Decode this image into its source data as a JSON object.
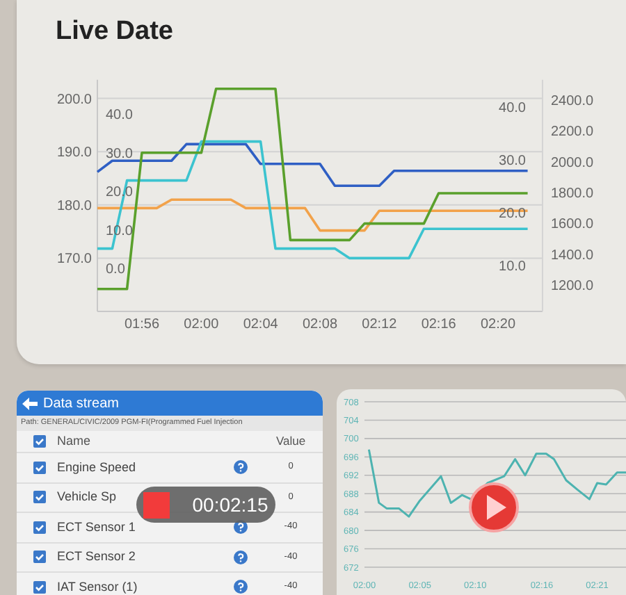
{
  "title": "Live Date",
  "live_chart": {
    "chart_data": {
      "type": "line",
      "grid": true,
      "x": [
        113,
        114,
        115,
        116,
        117,
        118,
        119,
        120,
        121,
        122,
        123,
        124,
        125,
        126,
        127,
        128,
        129,
        130,
        131,
        132,
        133,
        134,
        135,
        136,
        137,
        138,
        139,
        140,
        141,
        142
      ],
      "xlim": [
        113,
        143
      ],
      "ylim": [
        160,
        203.5
      ],
      "xticks": [
        {
          "value": 116,
          "label": "01:56"
        },
        {
          "value": 120,
          "label": "02:00"
        },
        {
          "value": 124,
          "label": "02:04"
        },
        {
          "value": 128,
          "label": "02:08"
        },
        {
          "value": 132,
          "label": "02:12"
        },
        {
          "value": 136,
          "label": "02:16"
        },
        {
          "value": 140,
          "label": "02:20"
        }
      ],
      "yticks": [
        {
          "value": 170,
          "label": "170.0"
        },
        {
          "value": 180,
          "label": "180.0"
        },
        {
          "value": 190,
          "label": "190.0"
        },
        {
          "value": 200,
          "label": "200.0"
        }
      ],
      "series": [
        {
          "color": "#2f5fc4",
          "values": [
            186.2,
            188.3,
            188.3,
            188.3,
            188.3,
            188.3,
            191.4,
            191.4,
            191.4,
            191.4,
            191.4,
            187.7,
            187.7,
            187.7,
            187.7,
            187.7,
            183.6,
            183.6,
            183.6,
            183.6,
            186.4,
            186.4,
            186.4,
            186.4,
            186.4,
            186.4,
            186.4,
            186.4,
            186.4,
            186.4
          ]
        },
        {
          "color": "#f2a24a",
          "values": [
            179.4,
            179.4,
            179.4,
            179.4,
            179.4,
            181,
            181,
            181,
            181,
            181,
            179.4,
            179.4,
            179.4,
            179.4,
            179.4,
            175.2,
            175.2,
            175.2,
            175.2,
            178.9,
            178.9,
            178.9,
            178.9,
            178.9,
            178.9,
            178.9,
            178.9,
            178.9,
            178.9,
            178.9
          ]
        },
        {
          "color": "#3cc3cf",
          "values": [
            171.8,
            171.8,
            184.6,
            184.6,
            184.6,
            184.6,
            184.6,
            191.9,
            191.9,
            191.9,
            191.9,
            191.9,
            171.8,
            171.8,
            171.8,
            171.8,
            171.8,
            170,
            170,
            170,
            170,
            170,
            175.5,
            175.5,
            175.5,
            175.5,
            175.5,
            175.5,
            175.5,
            175.5
          ]
        },
        {
          "color": "#5aa02c",
          "values": [
            164.2,
            164.2,
            164.2,
            189.8,
            189.8,
            189.8,
            189.8,
            189.8,
            201.8,
            201.8,
            201.8,
            201.8,
            201.8,
            173.4,
            173.4,
            173.4,
            173.4,
            173.4,
            176.5,
            176.5,
            176.5,
            176.5,
            176.5,
            182.2,
            182.2,
            182.2,
            182.2,
            182.2,
            182.2,
            182.2
          ]
        }
      ]
    },
    "extra_axes": [
      {
        "kind": "inner_left",
        "ticks": [
          "40.0",
          "30.0",
          "20.0",
          "10.0",
          "0.0"
        ]
      },
      {
        "kind": "inner_right",
        "ticks": [
          "40.0",
          "30.0",
          "20.0",
          "10.0"
        ]
      },
      {
        "kind": "right",
        "ticks": [
          "2400.0",
          "2200.0",
          "2000.0",
          "1800.0",
          "1600.0",
          "1400.0",
          "1200.0"
        ]
      }
    ]
  },
  "data_stream": {
    "title": "Data stream",
    "path": "Path:  GENERAL/CIVIC/2009 PGM-FI(Programmed Fuel Injection",
    "header": {
      "checked": true,
      "name": "Name",
      "value": "Value"
    },
    "rows": [
      {
        "checked": true,
        "name": "Engine Speed",
        "info_icon": true,
        "value": "0"
      },
      {
        "checked": true,
        "name": "Vehicle Sp",
        "info_icon": false,
        "value": "0"
      },
      {
        "checked": true,
        "name": "ECT Sensor 1",
        "info_icon": true,
        "value": "-40"
      },
      {
        "checked": true,
        "name": "ECT Sensor 2",
        "info_icon": true,
        "value": "-40"
      },
      {
        "checked": true,
        "name": "IAT Sensor (1)",
        "info_icon": true,
        "value": "-40"
      }
    ],
    "recording": {
      "time": "00:02:15"
    }
  },
  "video_chart": {
    "chart_data": {
      "type": "line",
      "grid": true,
      "x": [
        120.4,
        121.3,
        122.0,
        123.1,
        124.0,
        125.0,
        126.9,
        127.8,
        128.8,
        129.6,
        131.1,
        132.6,
        133.6,
        134.5,
        135.5,
        136.4,
        137.1,
        138.2,
        139.2,
        140.3,
        141.0,
        141.8,
        142.8,
        143.6
      ],
      "xlim": [
        120,
        143.6
      ],
      "ylim": [
        672,
        708
      ],
      "xticks": [
        {
          "value": 120,
          "label": "02:00"
        },
        {
          "value": 125,
          "label": "02:05"
        },
        {
          "value": 130,
          "label": "02:10"
        },
        {
          "value": 136,
          "label": "02:16"
        },
        {
          "value": 141,
          "label": "02:21"
        }
      ],
      "yticks": [
        672,
        676,
        680,
        684,
        688,
        692,
        696,
        700,
        704,
        708
      ],
      "series": [
        {
          "color": "#4db3b0",
          "values": [
            697.6,
            686,
            684.8,
            684.8,
            683,
            686.5,
            691.8,
            686,
            687.7,
            686.8,
            690.3,
            691.8,
            695.5,
            692,
            696.7,
            696.7,
            695.5,
            690.9,
            688.9,
            686.8,
            690.3,
            690,
            692.6,
            692.6
          ]
        }
      ]
    }
  }
}
